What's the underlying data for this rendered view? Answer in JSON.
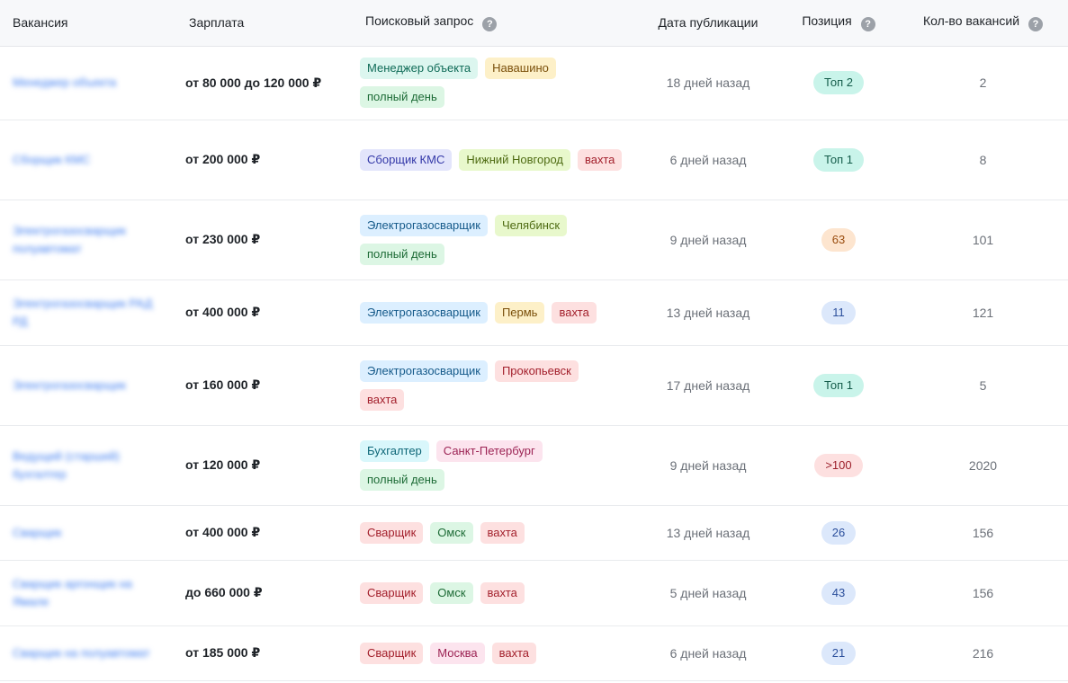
{
  "header": {
    "vacancy": "Вакансия",
    "salary": "Зарплата",
    "query": "Поисковый запрос",
    "date": "Дата публикации",
    "position": "Позиция",
    "count": "Кол-во вакансий",
    "help_glyph": "?"
  },
  "rows": [
    {
      "vacancy": "Менеджер объекта",
      "salary": "от 80 000 до 120 000 ₽",
      "tags": [
        "Менеджер объекта",
        "Навашино",
        "полный день"
      ],
      "date": "18 дней назад",
      "position": "Топ 2",
      "count": "2"
    },
    {
      "vacancy": "Сборщик КМС",
      "salary": "от 200 000 ₽",
      "tags": [
        "Сборщик КМС",
        "Нижний Новгород",
        "вахта"
      ],
      "date": "6 дней назад",
      "position": "Топ 1",
      "count": "8"
    },
    {
      "vacancy": "Электрогазосварщик полуавтомат",
      "salary": "от 230 000 ₽",
      "tags": [
        "Электрогазосварщик",
        "Челябинск",
        "полный день"
      ],
      "date": "9 дней назад",
      "position": "63",
      "count": "101"
    },
    {
      "vacancy": "Электрогазосварщик РАД РД",
      "salary": "от 400 000 ₽",
      "tags": [
        "Электрогазосварщик",
        "Пермь",
        "вахта"
      ],
      "date": "13 дней назад",
      "position": "11",
      "count": "121"
    },
    {
      "vacancy": "Электрогазосварщик",
      "salary": "от 160 000 ₽",
      "tags": [
        "Электрогазосварщик",
        "Прокопьевск",
        "вахта"
      ],
      "date": "17 дней назад",
      "position": "Топ 1",
      "count": "5"
    },
    {
      "vacancy": "Ведущий (старший) бухгалтер",
      "salary": "от 120 000 ₽",
      "tags": [
        "Бухгалтер",
        "Санкт-Петербург",
        "полный день"
      ],
      "date": "9 дней назад",
      "position": ">100",
      "count": "2020"
    },
    {
      "vacancy": "Сварщик",
      "salary": "от 400 000 ₽",
      "tags": [
        "Сварщик",
        "Омск",
        "вахта"
      ],
      "date": "13 дней назад",
      "position": "26",
      "count": "156"
    },
    {
      "vacancy": "Сварщик аргонщик на Ямале",
      "salary": "до 660 000 ₽",
      "tags": [
        "Сварщик",
        "Омск",
        "вахта"
      ],
      "date": "5 дней назад",
      "position": "43",
      "count": "156"
    },
    {
      "vacancy": "Сварщик на полуавтомат",
      "salary": "от 185 000 ₽",
      "tags": [
        "Сварщик",
        "Москва",
        "вахта"
      ],
      "date": "6 дней назад",
      "position": "21",
      "count": "216"
    }
  ]
}
